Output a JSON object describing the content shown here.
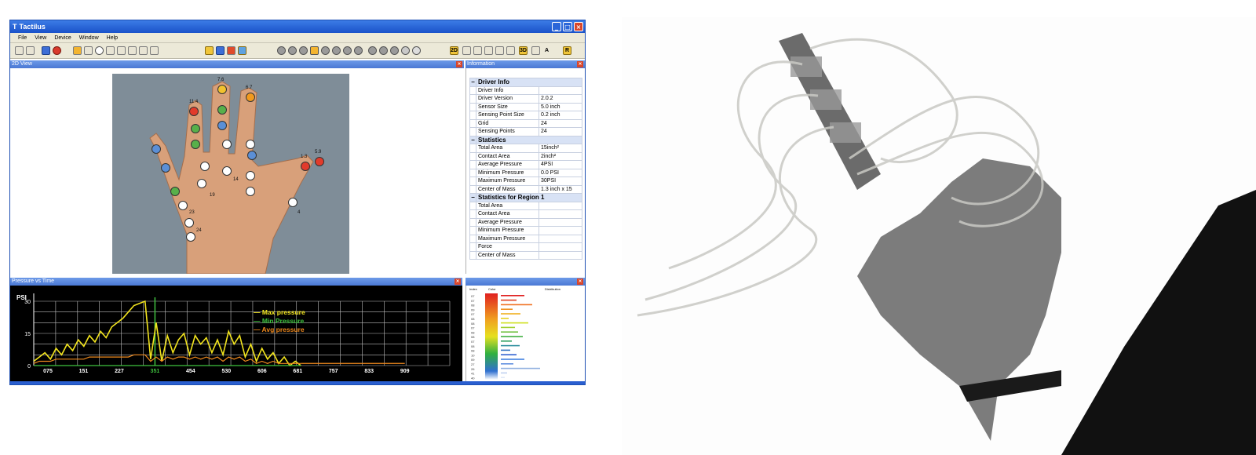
{
  "app": {
    "title": "Tactilus"
  },
  "menu": [
    "File",
    "View",
    "Device",
    "Window",
    "Help"
  ],
  "panels": {
    "view2d": "2D View",
    "information": "Information",
    "pvt": "Pressure vs Time"
  },
  "sensor_points": [
    {
      "label": "7.6",
      "color": "#f2c22e"
    },
    {
      "label": "6.7",
      "color": "#f39a1e"
    },
    {
      "label": "11.4",
      "color": "#e23b2b"
    },
    {
      "label": "",
      "color": "#58b04a"
    },
    {
      "label": "",
      "color": "#58b04a"
    },
    {
      "label": "",
      "color": "#5b8fd6"
    },
    {
      "label": "",
      "color": "#5b8fd6"
    },
    {
      "label": "",
      "color": "#5b8fd6"
    },
    {
      "label": "1.3",
      "color": "#e23b2b"
    },
    {
      "label": "5.9",
      "color": "#e23b2b"
    },
    {
      "label": "",
      "color": "#58b04a"
    },
    {
      "label": "",
      "color": "#58b04a"
    },
    {
      "label": "",
      "color": "#5b8fd6"
    },
    {
      "label": "",
      "color": "#ffffff"
    },
    {
      "label": "",
      "color": "#ffffff"
    },
    {
      "label": "",
      "color": "#ffffff"
    },
    {
      "label": "",
      "color": "#ffffff"
    },
    {
      "label": "",
      "color": "#ffffff"
    },
    {
      "label": "",
      "color": "#ffffff"
    },
    {
      "label": "",
      "color": "#ffffff"
    },
    {
      "label": "",
      "color": "#ffffff"
    },
    {
      "label": "",
      "color": "#ffffff"
    },
    {
      "label": "",
      "color": "#ffffff"
    },
    {
      "label": "",
      "color": "#ffffff"
    }
  ],
  "sensor_numbers": [
    "19",
    "14",
    "23",
    "24",
    "4"
  ],
  "info": {
    "sections": [
      {
        "title": "Driver Info",
        "rows": [
          [
            "Driver Info",
            ""
          ],
          [
            "Driver Version",
            "2.0.2"
          ],
          [
            "Sensor Size",
            "5.0 inch"
          ],
          [
            "Sensing Point Size",
            "0.2 inch"
          ],
          [
            "Grid",
            "24"
          ],
          [
            "Sensing Points",
            "24"
          ]
        ]
      },
      {
        "title": "Statistics",
        "rows": [
          [
            "Total Area",
            "15inch²"
          ],
          [
            "Contact Area",
            "2inch²"
          ],
          [
            "Average Pressure",
            "4PSI"
          ],
          [
            "Minimum Pressure",
            "0.0 PSI"
          ],
          [
            "Maximum Pressure",
            "30PSI"
          ],
          [
            "Center of Mass",
            "1.3 inch x 15"
          ]
        ]
      },
      {
        "title": "Statistics for Region 1",
        "rows": [
          [
            "Total Area",
            ""
          ],
          [
            "Contact Area",
            ""
          ],
          [
            "Average Pressure",
            ""
          ],
          [
            "Minimum Pressure",
            ""
          ],
          [
            "Maximum Pressure",
            ""
          ],
          [
            "Force",
            ""
          ],
          [
            "Center of Mass",
            ""
          ]
        ]
      }
    ]
  },
  "chart_data": {
    "type": "line",
    "ylabel": "PSI",
    "ylim": [
      0,
      30
    ],
    "yticks": [
      "30",
      "15",
      "0"
    ],
    "xticks": [
      "075",
      "151",
      "227",
      "351",
      "454",
      "530",
      "606",
      "681",
      "757",
      "833",
      "909"
    ],
    "highlight_tick": "351",
    "legend": [
      "Max pressure",
      "Min Pressure",
      "Avg pressure"
    ],
    "colors": {
      "max": "#f2e41e",
      "min": "#3fc23f",
      "avg": "#f08a1e",
      "highlight": "#3fc23f"
    },
    "series": [
      {
        "name": "Max pressure",
        "values": [
          2,
          4,
          6,
          3,
          8,
          5,
          10,
          7,
          12,
          9,
          14,
          11,
          16,
          13,
          18,
          20,
          22,
          25,
          28,
          29,
          30,
          3,
          20,
          2,
          14,
          6,
          12,
          15,
          5,
          14,
          10,
          13,
          6,
          12,
          5,
          16,
          10,
          14,
          4,
          10,
          2,
          8,
          3,
          6,
          1,
          4,
          0,
          2,
          0
        ]
      },
      {
        "name": "Min Pressure",
        "values": [
          0,
          0,
          0,
          0,
          0,
          0,
          0,
          0,
          0,
          0,
          0,
          0,
          0,
          0,
          0,
          0,
          0,
          0,
          0,
          0,
          0,
          0,
          0,
          0,
          0,
          0,
          0,
          0,
          0,
          0,
          0,
          0,
          0,
          0,
          0,
          0,
          0,
          0,
          0,
          0,
          0,
          0,
          0,
          0,
          0,
          0,
          0,
          0,
          0
        ]
      },
      {
        "name": "Avg pressure",
        "values": [
          1,
          2,
          2,
          2,
          3,
          3,
          3,
          3,
          3,
          3,
          4,
          4,
          4,
          4,
          4,
          4,
          4,
          4,
          5,
          5,
          5,
          2,
          4,
          2,
          4,
          3,
          4,
          4,
          3,
          4,
          3,
          4,
          3,
          4,
          2,
          4,
          3,
          4,
          2,
          3,
          1,
          2,
          1,
          2,
          1,
          1,
          1,
          1,
          1
        ]
      }
    ]
  },
  "distribution": {
    "headers": [
      "Index",
      "Color",
      "Distribution"
    ],
    "rows": [
      "07",
      "07",
      "08",
      "09",
      "07",
      "08",
      "08",
      "07",
      "08",
      "08",
      "07",
      "08",
      "08",
      "10",
      "09",
      "27",
      "26",
      "41",
      "40"
    ]
  }
}
